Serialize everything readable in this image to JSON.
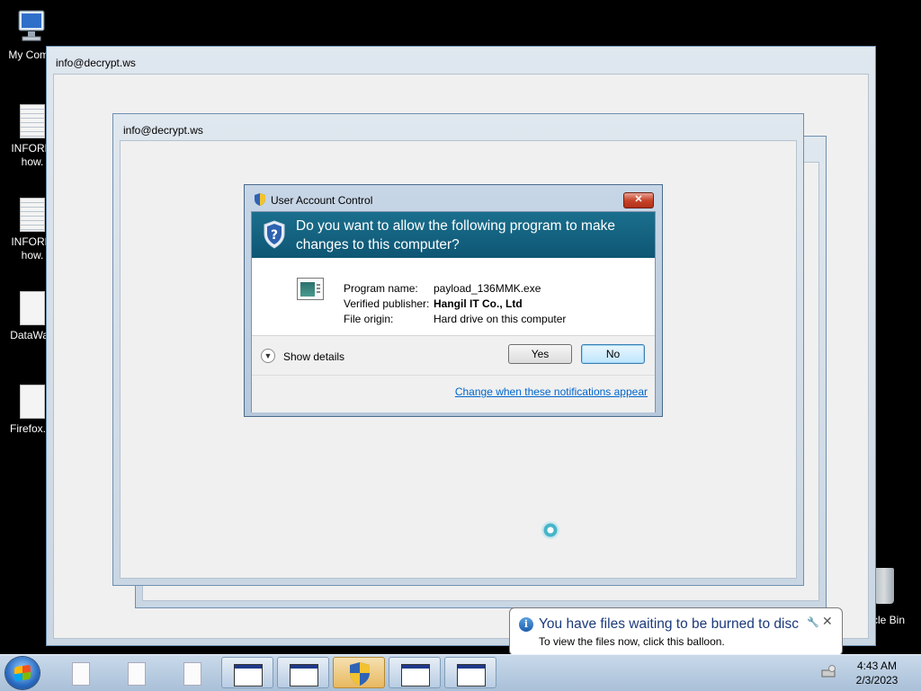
{
  "desktop": {
    "icons": [
      {
        "label": "My Comp",
        "label2": ""
      },
      {
        "label": "INFORM",
        "label2": "how."
      },
      {
        "label": "INFORM",
        "label2": "how."
      },
      {
        "label": "DataWag",
        "label2": ""
      },
      {
        "label": "Firefox.In",
        "label2": ""
      }
    ],
    "recycle_bin_label": "cle Bin"
  },
  "windows": {
    "outer_title": "info@decrypt.ws",
    "inner_title": "info@decrypt.ws"
  },
  "uac": {
    "title": "User Account Control",
    "close_glyph": "✕",
    "question": "Do you want to allow the following program to make changes to this computer?",
    "program_name_label": "Program name:",
    "program_name_value": "payload_136MMK.exe",
    "publisher_label": "Verified publisher:",
    "publisher_value": "Hangil IT Co., Ltd",
    "origin_label": "File origin:",
    "origin_value": "Hard drive on this computer",
    "show_details": "Show details",
    "yes_label": "Yes",
    "no_label": "No",
    "change_link": "Change when these notifications appear"
  },
  "balloon": {
    "title": "You have files waiting to be burned to disc",
    "body": "To view the files now, click this balloon.",
    "close_glyph": "✕",
    "options_glyph": "🔧"
  },
  "taskbar": {
    "clock_time": "4:43 AM",
    "clock_date": "2/3/2023"
  },
  "colors": {
    "uac_banner": "#0e5674",
    "link": "#0066cc"
  }
}
